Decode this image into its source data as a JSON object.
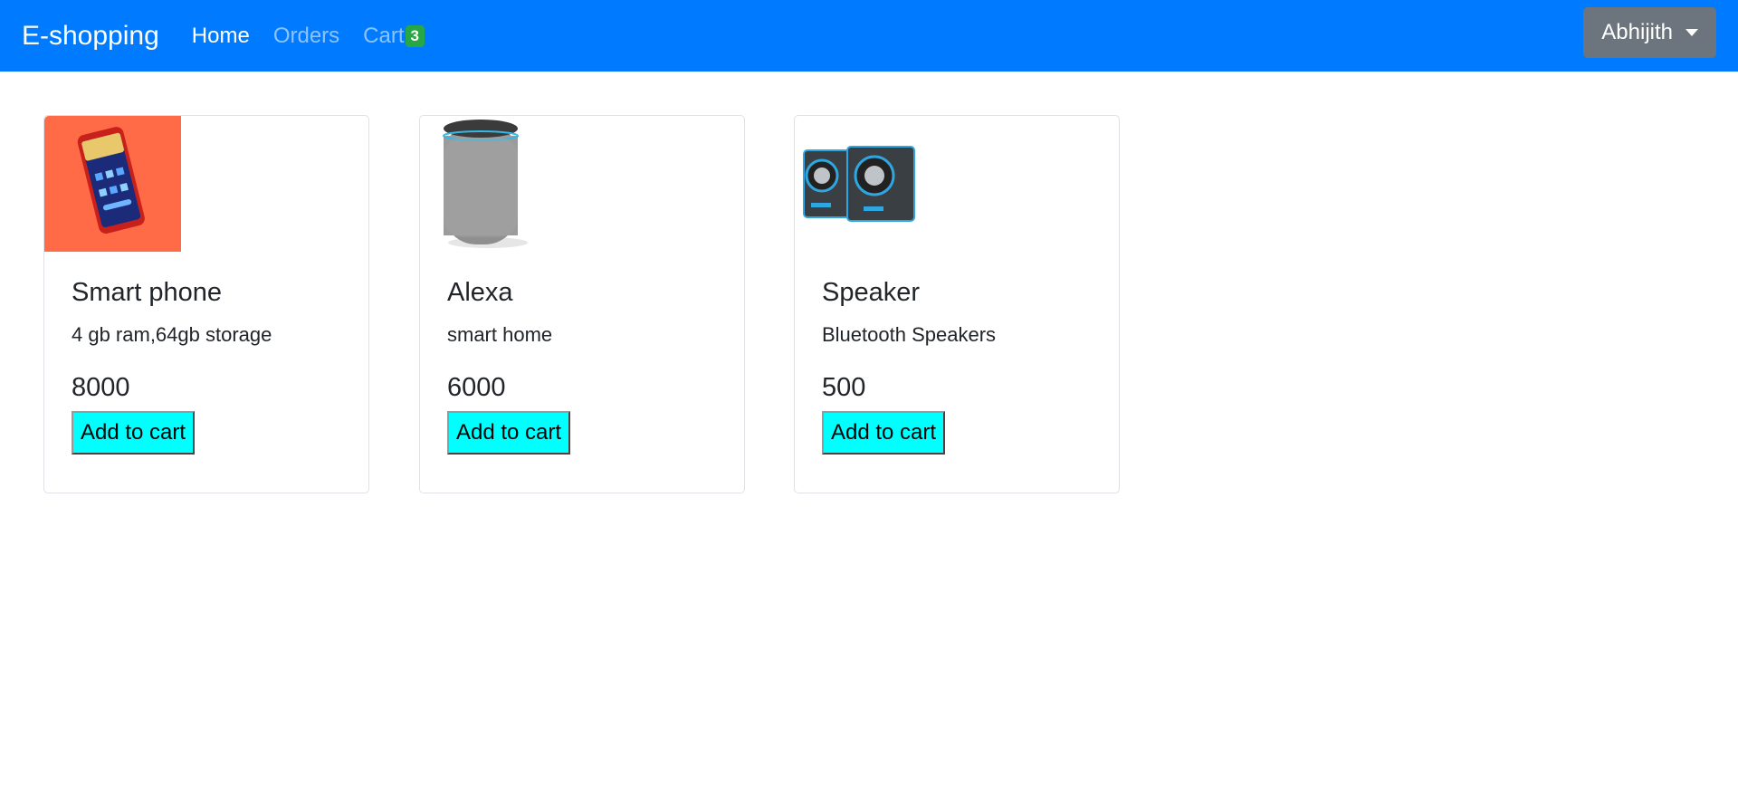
{
  "navbar": {
    "brand": "E-shopping",
    "links": [
      {
        "label": "Home"
      },
      {
        "label": "Orders"
      },
      {
        "label": "Cart"
      }
    ],
    "cart_count": "3",
    "user_label": "Abhijith"
  },
  "products": [
    {
      "title": "Smart phone",
      "description": "4 gb ram,64gb storage",
      "price": "8000",
      "button": "Add to cart",
      "image": "smartphone-image"
    },
    {
      "title": "Alexa",
      "description": "smart home",
      "price": "6000",
      "button": "Add to cart",
      "image": "smart-speaker-image"
    },
    {
      "title": "Speaker",
      "description": "Bluetooth Speakers",
      "price": "500",
      "button": "Add to cart",
      "image": "bluetooth-speakers-image"
    }
  ],
  "colors": {
    "navbar": "#007bff",
    "badge": "#28a745",
    "user_button": "#6c757d",
    "add_button": "#00ffff",
    "phone_image_bg": "#ff6b47"
  }
}
